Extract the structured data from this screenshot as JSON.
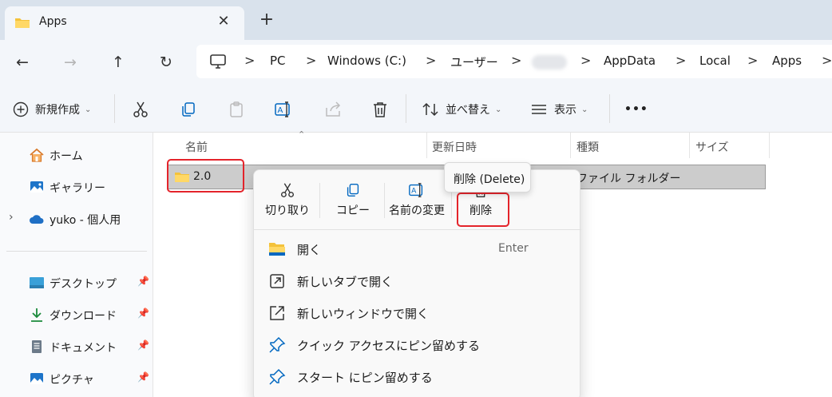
{
  "tab": {
    "title": "Apps",
    "close_glyph": "✕",
    "new_glyph": "+"
  },
  "nav": {
    "back": "←",
    "forward": "→",
    "up": "↑",
    "refresh": "↻"
  },
  "address": {
    "items": [
      "PC",
      "Windows (C:)",
      "ユーザー",
      "",
      "AppData",
      "Local",
      "Apps"
    ],
    "separator": ">",
    "trailing_separator": ">"
  },
  "toolbar": {
    "new_label": "新規作成",
    "sort_label": "並べ替え",
    "view_label": "表示",
    "more_label": "•••",
    "chevron": "⌄"
  },
  "sidebar": {
    "items": [
      {
        "label": "ホーム",
        "icon": "home-icon"
      },
      {
        "label": "ギャラリー",
        "icon": "gallery-icon"
      },
      {
        "label": "yuko - 個人用",
        "icon": "cloud-icon",
        "expander": "›"
      }
    ],
    "pinned": [
      {
        "label": "デスクトップ",
        "icon": "desktop-icon"
      },
      {
        "label": "ダウンロード",
        "icon": "download-icon"
      },
      {
        "label": "ドキュメント",
        "icon": "document-icon"
      },
      {
        "label": "ピクチャ",
        "icon": "picture-icon"
      }
    ],
    "pin_glyph": "📌"
  },
  "columns": {
    "name": "名前",
    "modified": "更新日時",
    "type": "種類",
    "size": "サイズ",
    "sort_glyph": "⌃"
  },
  "rows": [
    {
      "name": "2.0",
      "type": "ファイル フォルダー"
    }
  ],
  "context_menu": {
    "top_actions": [
      {
        "label": "切り取り",
        "icon": "scissors-icon"
      },
      {
        "label": "コピー",
        "icon": "copy-icon"
      },
      {
        "label": "名前の変更",
        "icon": "rename-icon"
      },
      {
        "label": "削除",
        "icon": "trash-icon"
      }
    ],
    "items": [
      {
        "label": "開く",
        "shortcut": "Enter",
        "icon": "folder-open-icon"
      },
      {
        "label": "新しいタブで開く",
        "shortcut": "",
        "icon": "new-tab-icon"
      },
      {
        "label": "新しいウィンドウで開く",
        "shortcut": "",
        "icon": "new-window-icon"
      },
      {
        "label": "クイック アクセスにピン留めする",
        "shortcut": "",
        "icon": "pin-icon"
      },
      {
        "label": "スタート にピン留めする",
        "shortcut": "",
        "icon": "pin-start-icon"
      }
    ]
  },
  "tooltip": {
    "text": "削除 (Delete)"
  },
  "colors": {
    "highlight": "#e4242b",
    "folder": "#f4c23b",
    "accent": "#0067c0"
  }
}
